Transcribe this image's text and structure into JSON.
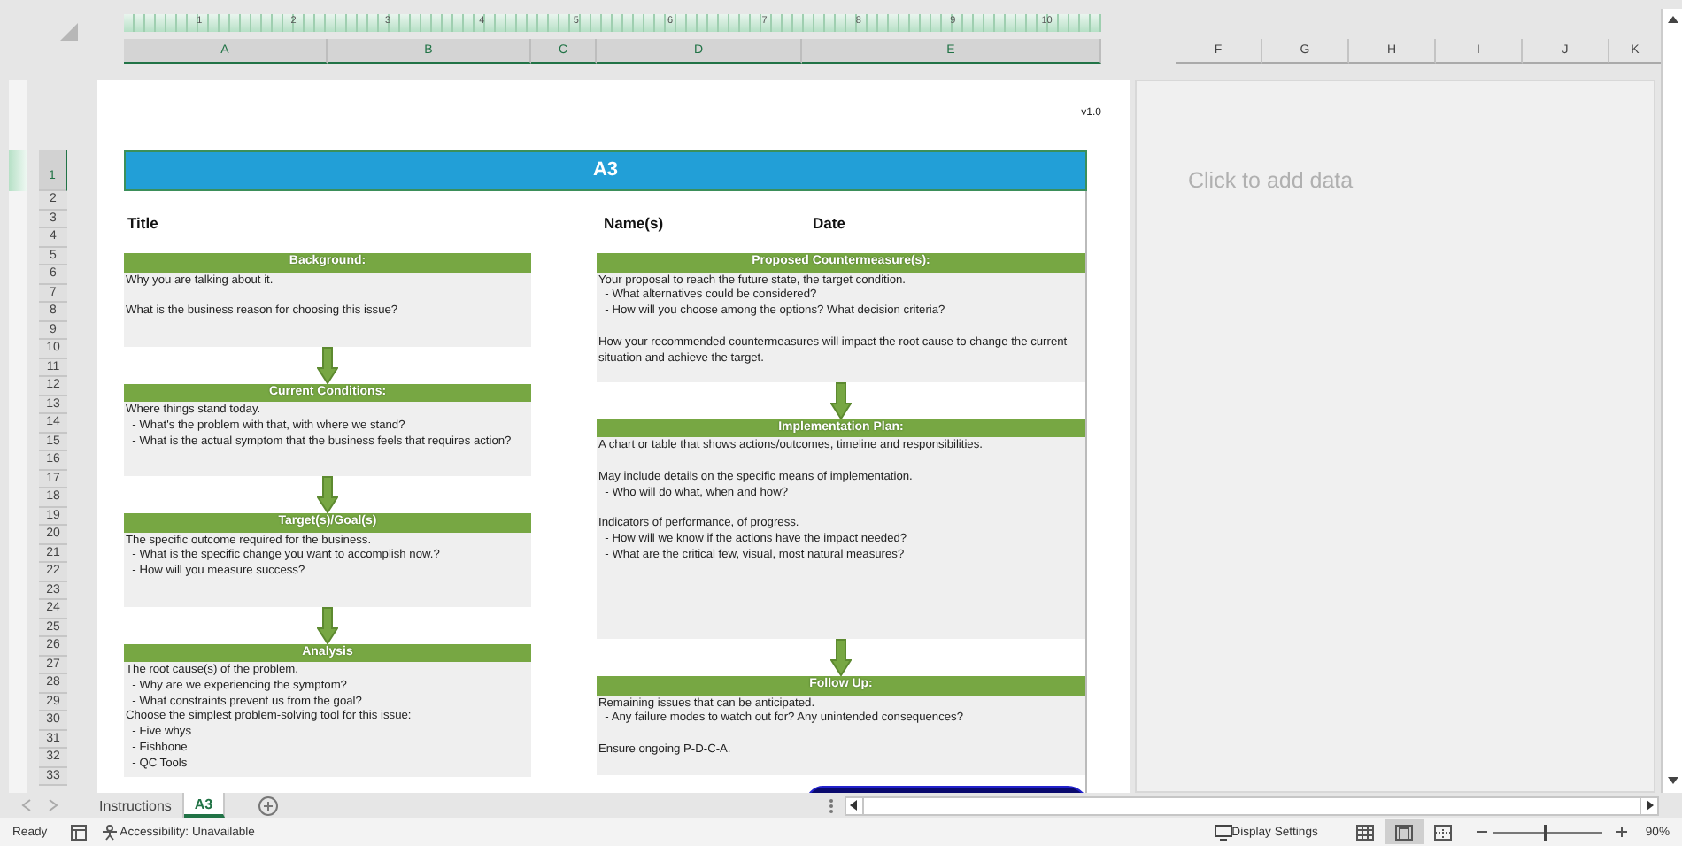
{
  "ruler": {
    "numbers": [
      "1",
      "2",
      "3",
      "4",
      "5",
      "6",
      "7",
      "8",
      "9",
      "10"
    ]
  },
  "page_columns": [
    {
      "label": "A",
      "selected": true
    },
    {
      "label": "B",
      "selected": true
    },
    {
      "label": "C",
      "selected": true
    },
    {
      "label": "D",
      "selected": true
    },
    {
      "label": "E",
      "selected": true
    }
  ],
  "side_columns": [
    {
      "label": "F",
      "selected": false
    },
    {
      "label": "G",
      "selected": false
    },
    {
      "label": "H",
      "selected": false
    },
    {
      "label": "I",
      "selected": false
    },
    {
      "label": "J",
      "selected": false
    },
    {
      "label": "K",
      "selected": false
    }
  ],
  "rows": [
    {
      "label": "1",
      "selected": true
    },
    {
      "label": "2",
      "selected": false
    },
    {
      "label": "3",
      "selected": false
    },
    {
      "label": "4",
      "selected": false
    },
    {
      "label": "5",
      "selected": false
    },
    {
      "label": "6",
      "selected": false
    },
    {
      "label": "7",
      "selected": false
    },
    {
      "label": "8",
      "selected": false
    },
    {
      "label": "9",
      "selected": false
    },
    {
      "label": "10",
      "selected": false
    },
    {
      "label": "11",
      "selected": false
    },
    {
      "label": "12",
      "selected": false
    },
    {
      "label": "13",
      "selected": false
    },
    {
      "label": "14",
      "selected": false
    },
    {
      "label": "15",
      "selected": false
    },
    {
      "label": "16",
      "selected": false
    },
    {
      "label": "17",
      "selected": false
    },
    {
      "label": "18",
      "selected": false
    },
    {
      "label": "19",
      "selected": false
    },
    {
      "label": "20",
      "selected": false
    },
    {
      "label": "21",
      "selected": false
    },
    {
      "label": "22",
      "selected": false
    },
    {
      "label": "23",
      "selected": false
    },
    {
      "label": "24",
      "selected": false
    },
    {
      "label": "25",
      "selected": false
    },
    {
      "label": "26",
      "selected": false
    },
    {
      "label": "27",
      "selected": false
    },
    {
      "label": "28",
      "selected": false
    },
    {
      "label": "29",
      "selected": false
    },
    {
      "label": "30",
      "selected": false
    },
    {
      "label": "31",
      "selected": false
    },
    {
      "label": "32",
      "selected": false
    },
    {
      "label": "33",
      "selected": false
    }
  ],
  "page": {
    "version": "v1.0",
    "banner": "A3",
    "header_fields": [
      "Title",
      "Name(s)",
      "Date"
    ],
    "left_sections": [
      {
        "title": "Background:",
        "paragraphs": [
          [
            "Why you are talking about it."
          ],
          [
            "What is the business reason for choosing this issue?"
          ]
        ]
      },
      {
        "title": "Current Conditions:",
        "paragraphs": [
          [
            "Where things stand today.",
            "  - What's the problem with that, with where we stand?",
            "  - What is the actual symptom that the business feels that requires action?"
          ]
        ]
      },
      {
        "title": "Target(s)/Goal(s)",
        "paragraphs": [
          [
            "The specific outcome required for the business.",
            "  - What is the specific change you want to accomplish now.?",
            "  - How will you measure success?"
          ]
        ]
      },
      {
        "title": "Analysis",
        "paragraphs": [
          [
            "The root cause(s) of the problem.",
            "  - Why are we experiencing the symptom?",
            "  - What constraints prevent us from the goal?",
            "Choose the simplest problem-solving tool for this issue:",
            "  - Five whys",
            "  - Fishbone",
            "  - QC Tools"
          ]
        ]
      }
    ],
    "right_sections": [
      {
        "title": "Proposed Countermeasure(s):",
        "paragraphs": [
          [
            "Your proposal to reach the future state, the target condition.",
            "  - What alternatives could be considered?",
            "  - How will you choose among the options? What decision criteria?"
          ],
          [
            "How your recommended countermeasures will impact the root cause to change the current situation and achieve the target."
          ]
        ]
      },
      {
        "title": "Implementation Plan:",
        "paragraphs": [
          [
            "A chart or table that shows actions/outcomes, timeline and responsibilities."
          ],
          [
            "May include details on the specific means of implementation.",
            "  - Who will do what, when and how?"
          ],
          [
            "Indicators of performance, of progress.",
            "  - How will we know if the actions have the impact needed?",
            "  - What are the critical few, visual, most natural measures?"
          ]
        ]
      },
      {
        "title": "Follow Up:",
        "paragraphs": [
          [
            "Remaining issues that can be anticipated.",
            "  - Any failure modes to watch out for? Any unintended consequences?"
          ],
          [
            "Ensure ongoing P-D-C-A."
          ]
        ]
      }
    ]
  },
  "side_page": {
    "hint": "Click to add data"
  },
  "sheet_tabs": [
    {
      "label": "Instructions",
      "selected": false
    },
    {
      "label": "A3",
      "selected": true
    }
  ],
  "status_bar": {
    "mode": "Ready",
    "accessibility": "Accessibility: Unavailable",
    "display_settings": "Display Settings",
    "views": [
      {
        "kind": "normal",
        "selected": false
      },
      {
        "kind": "page-layout",
        "selected": true
      },
      {
        "kind": "page-break",
        "selected": false
      }
    ],
    "zoom_slider": {
      "level": 0.47
    },
    "zoom": "90%"
  }
}
